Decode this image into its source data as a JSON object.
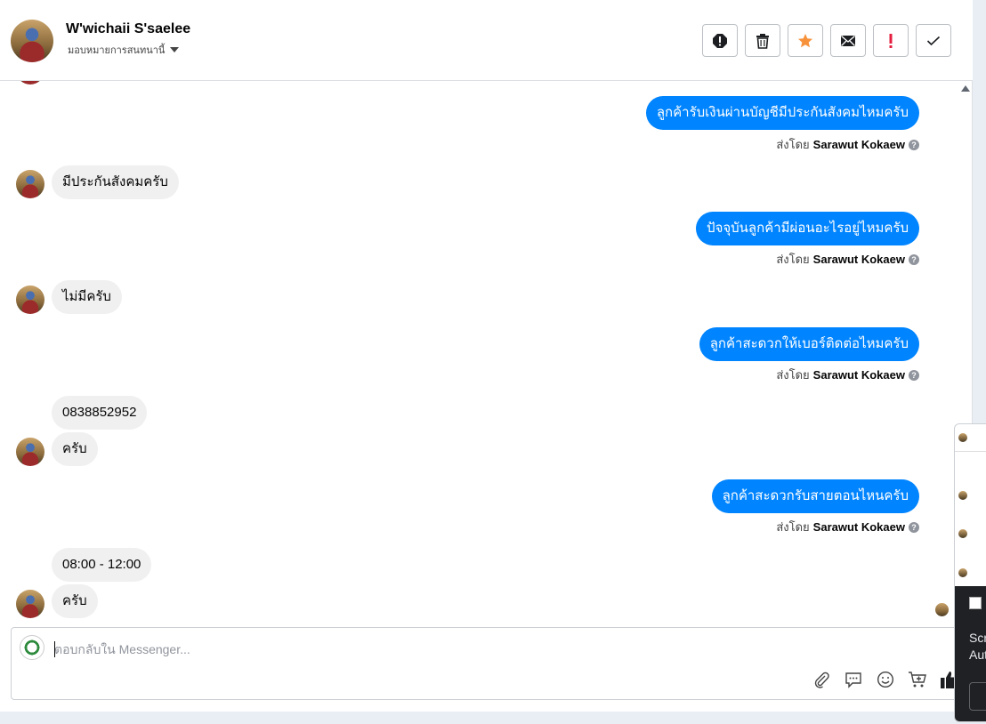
{
  "header": {
    "name": "W'wichaii S'saelee",
    "assign_label": "มอบหมายการสนทนานี้"
  },
  "actions": [
    "alert-circle-icon",
    "trash-icon",
    "star-icon",
    "mail-icon",
    "exclamation-icon",
    "check-icon"
  ],
  "action_colors": {
    "star": "#f7923b",
    "exclamation": "#e41e3f"
  },
  "messages": {
    "out_1": "ลูกค้ารับเงินผ่านบัญชีมีประกันสังคมไหมครับ",
    "in_1": "มีประกันสังคมครับ",
    "out_2": "ปัจจุบันลูกค้ามีผ่อนอะไรอยู่ไหมครับ",
    "in_2": "ไม่มีครับ",
    "out_3": "ลูกค้าสะดวกให้เบอร์ติดต่อไหมครับ",
    "in_3a": "0838852952",
    "in_3b": "ครับ",
    "out_4": "ลูกค้าสะดวกรับสายตอนไหนครับ",
    "in_4a": "08:00 - 12:00",
    "in_4b": "ครับ"
  },
  "sent_by": {
    "prefix": "ส่งโดย",
    "agent": "Sarawut Kokaew"
  },
  "composer": {
    "placeholder": "ตอบกลับใน Messenger..."
  },
  "overlay": {
    "line1": "Scre",
    "line2": "Aut"
  },
  "colors": {
    "accent": "#0084ff",
    "incoming": "#f0f0f0"
  }
}
